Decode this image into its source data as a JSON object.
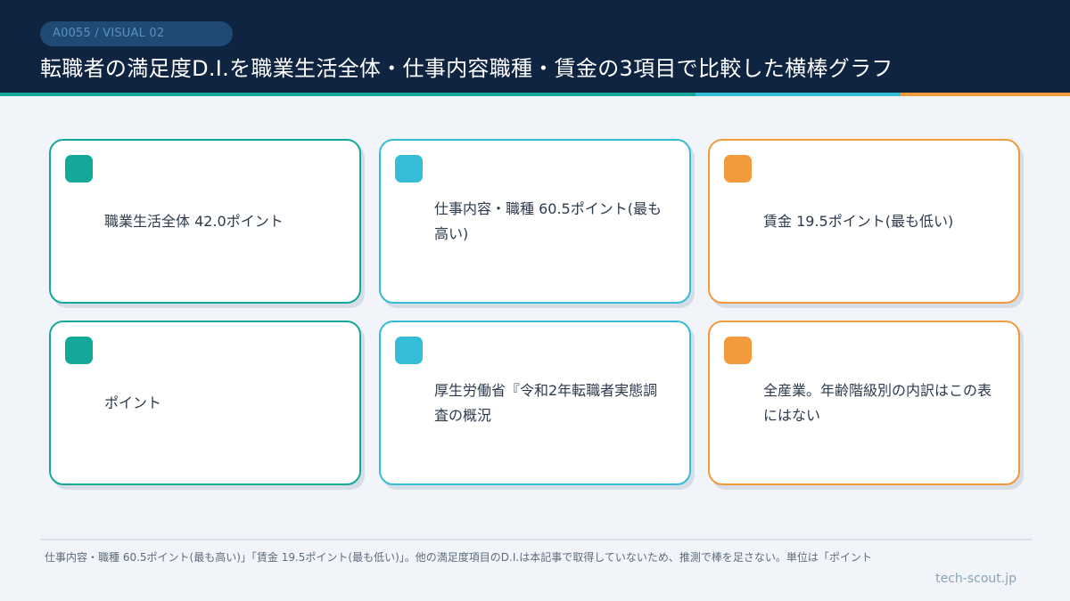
{
  "header": {
    "badge": "A0055 / VISUAL 02",
    "title": "転職者の満足度D.I.を職業生活全体・仕事内容職種・賃金の3項目で比較した横棒グラフ"
  },
  "colors": {
    "header_bg": "#0f2440",
    "teal": "#14a89a",
    "cyan": "#35bcd6",
    "orange": "#f29a3c",
    "page_bg": "#f1f5f9"
  },
  "cards": [
    {
      "text": "職業生活全体 42.0ポイント",
      "color": "teal"
    },
    {
      "text": "仕事内容・職種 60.5ポイント(最も高い)",
      "color": "cyan"
    },
    {
      "text": "賃金 19.5ポイント(最も低い)",
      "color": "orange"
    },
    {
      "text": "ポイント",
      "color": "teal"
    },
    {
      "text": "厚生労働省『令和2年転職者実態調査の概況",
      "color": "cyan"
    },
    {
      "text": "全産業。年齢階級別の内訳はこの表にはない",
      "color": "orange"
    }
  ],
  "footer": {
    "note": "仕事内容・職種 60.5ポイント(最も高い)」「賃金 19.5ポイント(最も低い)」。他の満足度項目のD.I.は本記事で取得していないため、推測で棒を足さない。単位は「ポイント",
    "site": "tech-scout.jp"
  }
}
